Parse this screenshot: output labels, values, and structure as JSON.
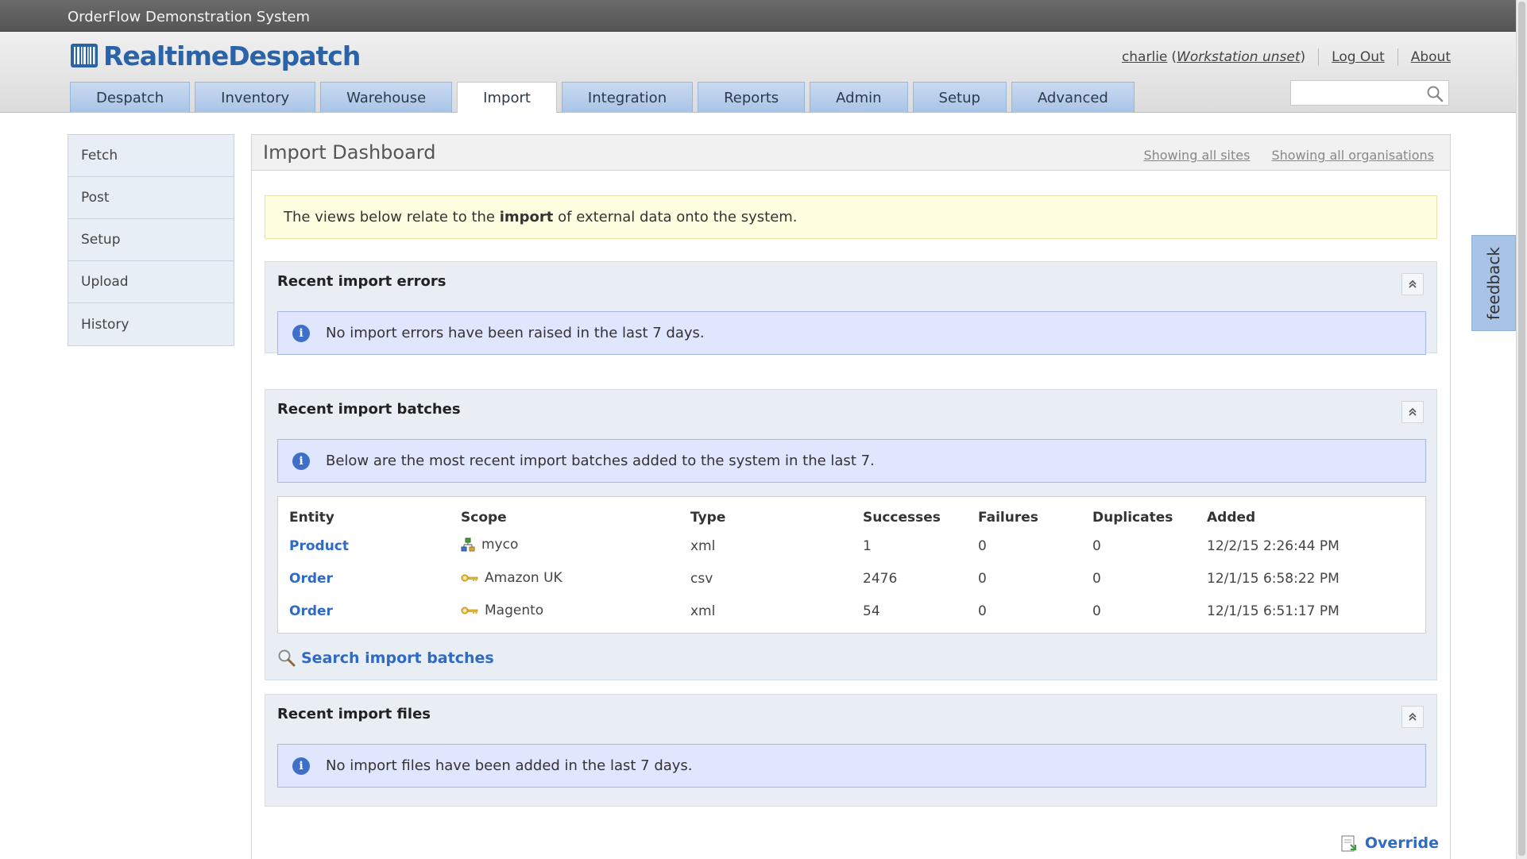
{
  "window": {
    "title": "OrderFlow Demonstration System"
  },
  "brand": {
    "logo_text": "RealtimeDespatch",
    "color": "#2b63a8"
  },
  "user": {
    "name": "charlie",
    "workstation_prefix": "(",
    "workstation": "Workstation unset",
    "workstation_suffix": ")",
    "logout": "Log Out",
    "about": "About"
  },
  "tabs": [
    {
      "label": "Despatch"
    },
    {
      "label": "Inventory"
    },
    {
      "label": "Warehouse"
    },
    {
      "label": "Import",
      "active": true
    },
    {
      "label": "Integration"
    },
    {
      "label": "Reports"
    },
    {
      "label": "Admin"
    },
    {
      "label": "Setup"
    },
    {
      "label": "Advanced"
    }
  ],
  "search": {
    "placeholder": "",
    "icon": "search-icon"
  },
  "sidebar": {
    "items": [
      {
        "label": "Fetch"
      },
      {
        "label": "Post"
      },
      {
        "label": "Setup"
      },
      {
        "label": "Upload"
      },
      {
        "label": "History"
      }
    ]
  },
  "main": {
    "title": "Import Dashboard",
    "filter_sites": "Showing all sites",
    "filter_orgs": "Showing all organisations",
    "notice": {
      "before": "The views below relate to the ",
      "bold": "import",
      "after": " of external data onto the system."
    },
    "errors_panel": {
      "title": "Recent import errors",
      "info": "No import errors have been raised in the last 7 days."
    },
    "batches_panel": {
      "title": "Recent import batches",
      "info": "Below are the most recent import batches added to the system in the last 7.",
      "columns": [
        "Entity",
        "Scope",
        "Type",
        "Successes",
        "Failures",
        "Duplicates",
        "Added"
      ],
      "rows": [
        {
          "entity": "Product",
          "scope": "myco",
          "scope_icon": "organisation-icon",
          "type": "xml",
          "successes": "1",
          "failures": "0",
          "duplicates": "0",
          "added": "12/2/15 2:26:44 PM"
        },
        {
          "entity": "Order",
          "scope": "Amazon UK",
          "scope_icon": "channel-key-icon",
          "type": "csv",
          "successes": "2476",
          "failures": "0",
          "duplicates": "0",
          "added": "12/1/15 6:58:22 PM"
        },
        {
          "entity": "Order",
          "scope": "Magento",
          "scope_icon": "channel-key-icon",
          "type": "xml",
          "successes": "54",
          "failures": "0",
          "duplicates": "0",
          "added": "12/1/15 6:51:17 PM"
        }
      ],
      "search_link": "Search import batches"
    },
    "files_panel": {
      "title": "Recent import files",
      "info": "No import files have been added in the last 7 days."
    },
    "override": "Override"
  },
  "feedback": "feedback",
  "colors": {
    "link": "#2f6ac5",
    "tab": "#b9d0ec",
    "info_bg": "#dfe6fd",
    "notice_bg": "#fffee0"
  }
}
